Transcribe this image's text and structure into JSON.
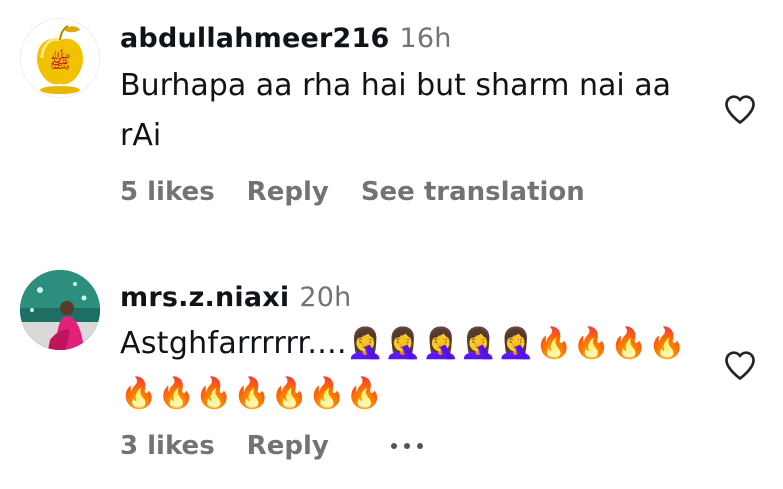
{
  "comments": [
    {
      "username": "abdullahmeer216",
      "time": "16h",
      "text": "Burhapa aa rha hai but sharm nai aa rAi",
      "likes": "5 likes",
      "reply": "Reply",
      "translation": "See translation",
      "avatar_icon": "golden-apple-avatar"
    },
    {
      "username": "mrs.z.niaxi",
      "time": "20h",
      "text": "Astghfarrrrrr....🤦‍♀️🤦‍♀️🤦‍♀️🤦‍♀️🤦‍♀️🔥🔥🔥🔥🔥🔥🔥🔥🔥🔥🔥",
      "likes": "3 likes",
      "reply": "Reply",
      "more_icon": "more-options-icon",
      "avatar_icon": "profile-photo-avatar"
    }
  ],
  "icons": {
    "like": "heart-outline-icon"
  },
  "colors": {
    "text": "#0f1419",
    "secondary": "#737373",
    "background": "#ffffff"
  }
}
